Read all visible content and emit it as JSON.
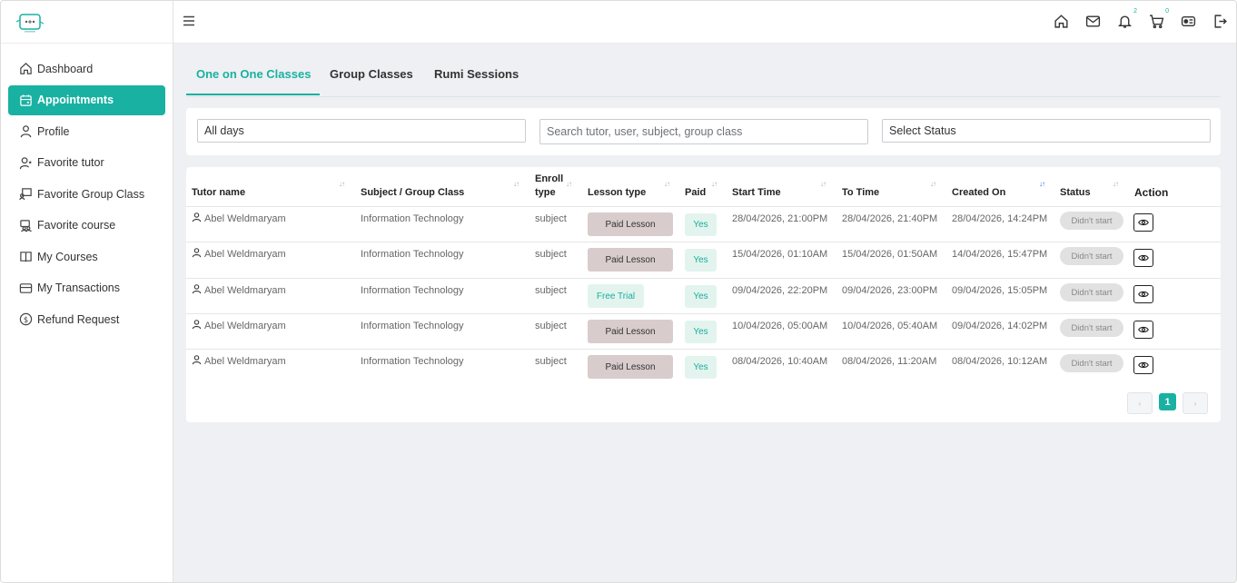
{
  "sidebar": {
    "items": [
      {
        "label": "Dashboard",
        "icon": "home-icon"
      },
      {
        "label": "Appointments",
        "icon": "calendar-icon",
        "active": true
      },
      {
        "label": "Profile",
        "icon": "user-icon"
      },
      {
        "label": "Favorite tutor",
        "icon": "user-star-icon"
      },
      {
        "label": "Favorite Group Class",
        "icon": "presentation-icon"
      },
      {
        "label": "Favorite course",
        "icon": "users-icon"
      },
      {
        "label": "My Courses",
        "icon": "book-icon"
      },
      {
        "label": "My Transactions",
        "icon": "card-icon"
      },
      {
        "label": "Refund Request",
        "icon": "dollar-circle-icon"
      }
    ]
  },
  "topbar": {
    "notification_count": "2",
    "cart_count": "0"
  },
  "tabs": [
    "One on One Classes",
    "Group Classes",
    "Rumi Sessions"
  ],
  "filters": {
    "days_value": "All days",
    "search_placeholder": "Search tutor, user, subject, group class",
    "status_placeholder": "Select Status"
  },
  "table": {
    "headers": {
      "tutor": "Tutor name",
      "subject": "Subject / Group Class",
      "enroll_1": "Enroll",
      "enroll_2": "type",
      "lesson": "Lesson type",
      "paid": "Paid",
      "start": "Start Time",
      "to": "To Time",
      "created": "Created On",
      "status": "Status",
      "action": "Action"
    },
    "rows": [
      {
        "tutor": "Abel Weldmaryam",
        "subject": "Information Technology",
        "enroll": "subject",
        "lesson": "Paid Lesson",
        "paid": "Yes",
        "start": "28/04/2026, 21:00PM",
        "to": "28/04/2026, 21:40PM",
        "created": "28/04/2026, 14:24PM",
        "status": "Didn't start"
      },
      {
        "tutor": "Abel Weldmaryam",
        "subject": "Information Technology",
        "enroll": "subject",
        "lesson": "Paid Lesson",
        "paid": "Yes",
        "start": "15/04/2026, 01:10AM",
        "to": "15/04/2026, 01:50AM",
        "created": "14/04/2026, 15:47PM",
        "status": "Didn't start"
      },
      {
        "tutor": "Abel Weldmaryam",
        "subject": "Information Technology",
        "enroll": "subject",
        "lesson": "Free Trial",
        "paid": "Yes",
        "start": "09/04/2026, 22:20PM",
        "to": "09/04/2026, 23:00PM",
        "created": "09/04/2026, 15:05PM",
        "status": "Didn't start"
      },
      {
        "tutor": "Abel Weldmaryam",
        "subject": "Information Technology",
        "enroll": "subject",
        "lesson": "Paid Lesson",
        "paid": "Yes",
        "start": "10/04/2026, 05:00AM",
        "to": "10/04/2026, 05:40AM",
        "created": "09/04/2026, 14:02PM",
        "status": "Didn't start"
      },
      {
        "tutor": "Abel Weldmaryam",
        "subject": "Information Technology",
        "enroll": "subject",
        "lesson": "Paid Lesson",
        "paid": "Yes",
        "start": "08/04/2026, 10:40AM",
        "to": "08/04/2026, 11:20AM",
        "created": "08/04/2026, 10:12AM",
        "status": "Didn't start"
      }
    ]
  },
  "pagination": {
    "current": "1",
    "prev": "‹",
    "next": "›"
  },
  "colors": {
    "accent": "#19b1a2",
    "paid_lesson_bg": "#d8cccc",
    "badge_green_bg": "#e3f4ef",
    "status_bg": "#e1e1e1",
    "content_bg": "#eef0f3"
  }
}
